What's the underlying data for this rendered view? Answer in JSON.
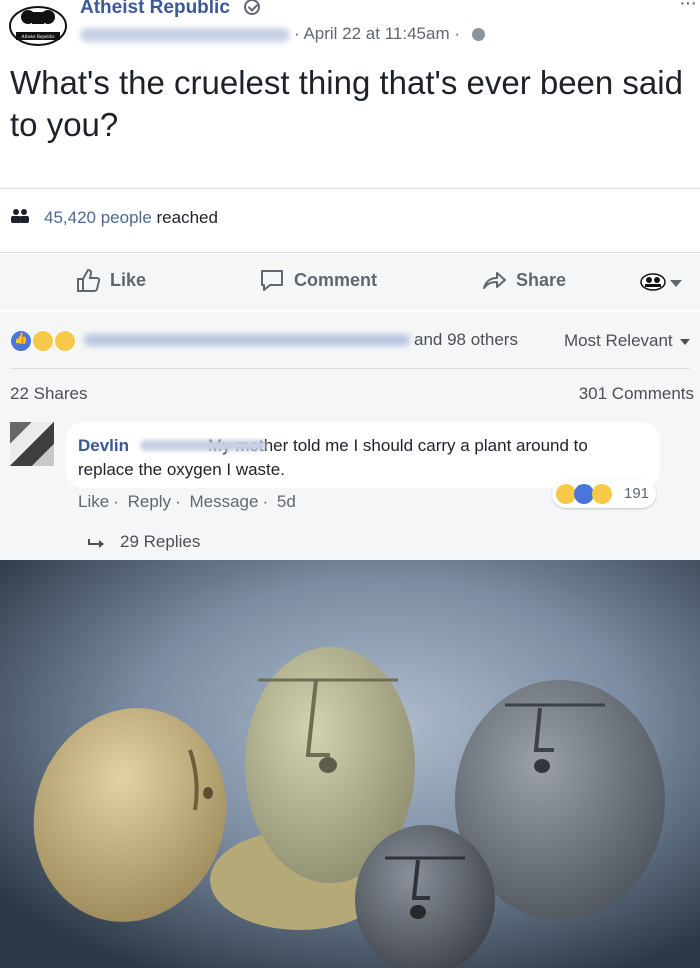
{
  "post": {
    "page_name": "Atheist Republic",
    "time": "· April 22 at 11:45am ·",
    "text": "What's the cruelest thing that's ever been said to you?",
    "reach_number": "45,420 people",
    "reach_suffix": "reached"
  },
  "actions": {
    "like": "Like",
    "comment": "Comment",
    "share": "Share"
  },
  "reactions": {
    "others": "and 98 others",
    "sort": "Most Relevant",
    "shares": "22 Shares",
    "comments": "301 Comments"
  },
  "comment": {
    "author": "Devlin",
    "text": "My mother told me I should carry a plant around to replace the oxygen I waste.",
    "reaction_count": "191",
    "meta": {
      "like": "Like",
      "reply": "Reply",
      "message": "Message",
      "age": "5d"
    },
    "replies": "29 Replies"
  },
  "colors": {
    "link": "#3b5998",
    "text": "#1d2129",
    "muted": "#606770",
    "panel": "#f5f6f7"
  }
}
